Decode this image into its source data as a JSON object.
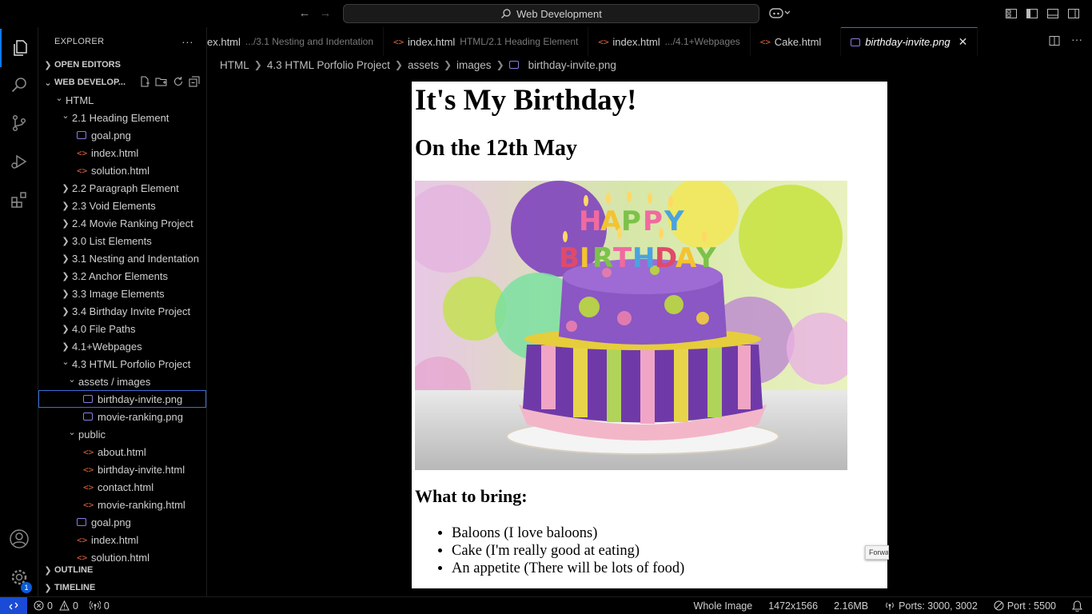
{
  "titlebar": {
    "command_center": "Web Development"
  },
  "activity_bar": {
    "settings_badge": "1"
  },
  "sidebar": {
    "title": "EXPLORER",
    "open_editors": "OPEN EDITORS",
    "workspace": "WEB DEVELOP...",
    "tree": [
      {
        "label": "HTML",
        "type": "folder-open",
        "indent": 0
      },
      {
        "label": "2.1 Heading Element",
        "type": "folder-open",
        "indent": 1
      },
      {
        "label": "goal.png",
        "type": "image",
        "indent": 2
      },
      {
        "label": "index.html",
        "type": "html",
        "indent": 2
      },
      {
        "label": "solution.html",
        "type": "html",
        "indent": 2
      },
      {
        "label": "2.2 Paragraph Element",
        "type": "folder",
        "indent": 1
      },
      {
        "label": "2.3 Void Elements",
        "type": "folder",
        "indent": 1
      },
      {
        "label": "2.4 Movie Ranking Project",
        "type": "folder",
        "indent": 1
      },
      {
        "label": "3.0 List Elements",
        "type": "folder",
        "indent": 1
      },
      {
        "label": "3.1 Nesting and Indentation",
        "type": "folder",
        "indent": 1
      },
      {
        "label": "3.2 Anchor Elements",
        "type": "folder",
        "indent": 1
      },
      {
        "label": "3.3 Image Elements",
        "type": "folder",
        "indent": 1
      },
      {
        "label": "3.4 Birthday Invite Project",
        "type": "folder",
        "indent": 1
      },
      {
        "label": "4.0 File Paths",
        "type": "folder",
        "indent": 1
      },
      {
        "label": "4.1+Webpages",
        "type": "folder",
        "indent": 1
      },
      {
        "label": "4.3 HTML Porfolio Project",
        "type": "folder-open",
        "indent": 1
      },
      {
        "label": "assets / images",
        "type": "folder-open",
        "indent": 2
      },
      {
        "label": "birthday-invite.png",
        "type": "image",
        "indent": 3,
        "selected": true
      },
      {
        "label": "movie-ranking.png",
        "type": "image",
        "indent": 3
      },
      {
        "label": "public",
        "type": "folder-open",
        "indent": 2
      },
      {
        "label": "about.html",
        "type": "html",
        "indent": 3
      },
      {
        "label": "birthday-invite.html",
        "type": "html",
        "indent": 3
      },
      {
        "label": "contact.html",
        "type": "html",
        "indent": 3
      },
      {
        "label": "movie-ranking.html",
        "type": "html",
        "indent": 3
      },
      {
        "label": "goal.png",
        "type": "image",
        "indent": 2
      },
      {
        "label": "index.html",
        "type": "html",
        "indent": 2
      },
      {
        "label": "solution.html",
        "type": "html",
        "indent": 2
      }
    ],
    "outline": "OUTLINE",
    "timeline": "TIMELINE"
  },
  "tabs": [
    {
      "name": "ex.html",
      "desc": ".../3.1 Nesting and Indentation",
      "type": "html"
    },
    {
      "name": "index.html",
      "desc": "HTML/2.1 Heading Element",
      "type": "html"
    },
    {
      "name": "index.html",
      "desc": ".../4.1+Webpages",
      "type": "html"
    },
    {
      "name": "Cake.html",
      "desc": "",
      "type": "html"
    },
    {
      "name": "birthday-invite.png",
      "desc": "",
      "type": "image",
      "active": true
    }
  ],
  "breadcrumb": [
    "HTML",
    "4.3 HTML Porfolio Project",
    "assets",
    "images",
    "birthday-invite.png"
  ],
  "preview": {
    "heading": "It's My Birthday!",
    "subheading": "On the 12th May",
    "bring_heading": "What to bring:",
    "items": [
      "Baloons (I love baloons)",
      "Cake (I'm really good at eating)",
      "An appetite (There will be lots of food)"
    ],
    "cake_text": "HAPPY BIRTHDAY",
    "hint": "Forwa"
  },
  "statusbar": {
    "errors": "0",
    "warnings": "0",
    "ports_count": "0",
    "whole_image": "Whole Image",
    "dimensions": "1472x1566",
    "size": "2.16MB",
    "ports": "Ports: 3000, 3002",
    "port": "Port : 5500"
  },
  "colors": {
    "accent": "#0a7aff",
    "remote": "#1a4bd6",
    "html_icon": "#e0643b",
    "image_icon": "#8c7be0"
  }
}
